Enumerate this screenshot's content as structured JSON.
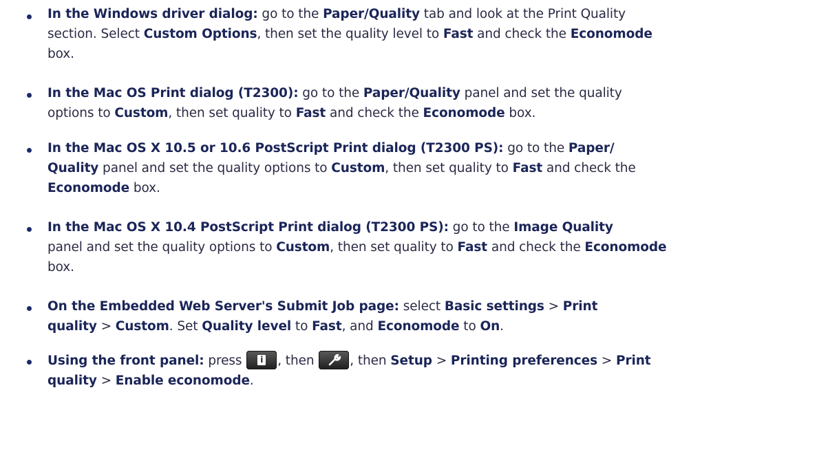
{
  "items": [
    {
      "lines": [
        [
          {
            "t": "In the Windows driver dialog:",
            "b": true
          },
          {
            "t": " go to the ",
            "b": false
          },
          {
            "t": "Paper/Quality",
            "b": true
          },
          {
            "t": " tab and look at the Print Quality",
            "b": false
          }
        ],
        [
          {
            "t": "section. Select ",
            "b": false
          },
          {
            "t": "Custom Options",
            "b": true
          },
          {
            "t": ", then set the quality level to ",
            "b": false
          },
          {
            "t": "Fast",
            "b": true
          },
          {
            "t": " and check the ",
            "b": false
          },
          {
            "t": "Economode",
            "b": true
          }
        ],
        [
          {
            "t": "box.",
            "b": false
          }
        ]
      ]
    },
    {
      "lines": [
        [
          {
            "t": "In the Mac OS Print dialog (T2300):",
            "b": true
          },
          {
            "t": " go to the ",
            "b": false
          },
          {
            "t": "Paper/Quality",
            "b": true
          },
          {
            "t": " panel and set the quality",
            "b": false
          }
        ],
        [
          {
            "t": "options to ",
            "b": false
          },
          {
            "t": "Custom",
            "b": true
          },
          {
            "t": ", then set quality to ",
            "b": false
          },
          {
            "t": "Fast",
            "b": true
          },
          {
            "t": " and check the ",
            "b": false
          },
          {
            "t": "Economode",
            "b": true
          },
          {
            "t": " box.",
            "b": false
          }
        ]
      ]
    },
    {
      "lines": [
        [
          {
            "t": "In the Mac OS X 10.5 or 10.6 PostScript Print dialog (T2300 PS):",
            "b": true
          },
          {
            "t": " go to the ",
            "b": false
          },
          {
            "t": "Paper/",
            "b": true
          }
        ],
        [
          {
            "t": "Quality",
            "b": true
          },
          {
            "t": " panel and set the quality options to ",
            "b": false
          },
          {
            "t": "Custom",
            "b": true
          },
          {
            "t": ", then set quality to ",
            "b": false
          },
          {
            "t": "Fast",
            "b": true
          },
          {
            "t": " and check the",
            "b": false
          }
        ],
        [
          {
            "t": "Economode",
            "b": true
          },
          {
            "t": " box.",
            "b": false
          }
        ]
      ]
    },
    {
      "lines": [
        [
          {
            "t": "In the Mac OS X 10.4 PostScript Print dialog (T2300 PS):",
            "b": true
          },
          {
            "t": " go to the ",
            "b": false
          },
          {
            "t": "Image Quality",
            "b": true
          }
        ],
        [
          {
            "t": "panel and set the quality options to ",
            "b": false
          },
          {
            "t": "Custom",
            "b": true
          },
          {
            "t": ", then set quality to ",
            "b": false
          },
          {
            "t": "Fast",
            "b": true
          },
          {
            "t": " and check the ",
            "b": false
          },
          {
            "t": "Economode",
            "b": true
          }
        ],
        [
          {
            "t": "box.",
            "b": false
          }
        ]
      ]
    },
    {
      "lines": [
        [
          {
            "t": "On the Embedded Web Server's Submit Job page:",
            "b": true
          },
          {
            "t": " select ",
            "b": false
          },
          {
            "t": "Basic settings",
            "b": true
          },
          {
            "t": " > ",
            "b": false
          },
          {
            "t": "Print",
            "b": true
          }
        ],
        [
          {
            "t": "quality",
            "b": true
          },
          {
            "t": " > ",
            "b": false
          },
          {
            "t": "Custom",
            "b": true
          },
          {
            "t": ". Set ",
            "b": false
          },
          {
            "t": "Quality level",
            "b": true
          },
          {
            "t": " to ",
            "b": false
          },
          {
            "t": "Fast",
            "b": true
          },
          {
            "t": ", and ",
            "b": false
          },
          {
            "t": "Economode",
            "b": true
          },
          {
            "t": " to ",
            "b": false
          },
          {
            "t": "On",
            "b": true
          },
          {
            "t": ".",
            "b": false
          }
        ]
      ]
    },
    {
      "lines": [
        [
          {
            "t": "Using the front panel:",
            "b": true
          },
          {
            "t": " press ",
            "b": false
          },
          {
            "icon": "info-button-icon"
          },
          {
            "t": ", then ",
            "b": false
          },
          {
            "icon": "wrench-button-icon"
          },
          {
            "t": ", then ",
            "b": false
          },
          {
            "t": "Setup",
            "b": true
          },
          {
            "t": " > ",
            "b": false
          },
          {
            "t": "Printing preferences",
            "b": true
          },
          {
            "t": " > ",
            "b": false
          },
          {
            "t": "Print",
            "b": true
          }
        ],
        [
          {
            "t": "quality",
            "b": true
          },
          {
            "t": " > ",
            "b": false
          },
          {
            "t": "Enable economode",
            "b": true
          },
          {
            "t": ".",
            "b": false
          }
        ]
      ]
    }
  ]
}
